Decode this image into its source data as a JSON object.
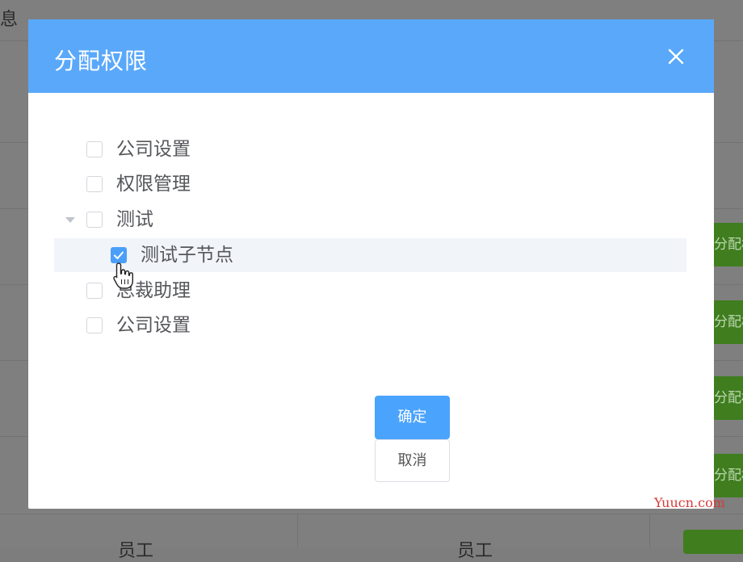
{
  "background": {
    "header_fragment": "息",
    "row_button_label": "分配权",
    "footer_cells": [
      "员工",
      "员工"
    ]
  },
  "dialog": {
    "title": "分配权限",
    "close_icon": "close-icon",
    "tree": [
      {
        "label": "公司设置",
        "checked": false,
        "level": 0,
        "expandable": false
      },
      {
        "label": "权限管理",
        "checked": false,
        "level": 0,
        "expandable": false
      },
      {
        "label": "测试",
        "checked": false,
        "level": 0,
        "expandable": true,
        "expanded": true
      },
      {
        "label": "测试子节点",
        "checked": true,
        "level": 1,
        "expandable": false,
        "highlighted": true
      },
      {
        "label": "总裁助理",
        "checked": false,
        "level": 0,
        "expandable": false
      },
      {
        "label": "公司设置",
        "checked": false,
        "level": 0,
        "expandable": false
      }
    ],
    "confirm_label": "确定",
    "cancel_label": "取消"
  },
  "watermark": "Yuucn.com",
  "colors": {
    "header": "#5aa8fa",
    "primary": "#4aa3fd",
    "overlay": "#7f7f7f",
    "action_green": "#3f7d1f"
  }
}
